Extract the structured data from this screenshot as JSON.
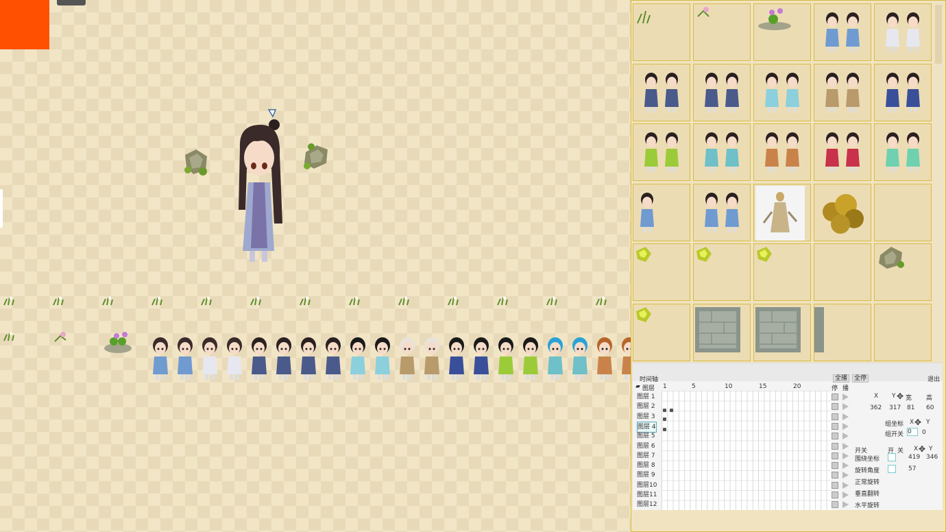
{
  "timeline": {
    "tab_label": "时间轴",
    "layers_header": "图层",
    "frame_numbers": [
      "1",
      "5",
      "10",
      "15",
      "20"
    ],
    "play_all": "全播",
    "stop_all": "全停",
    "exit": "退出",
    "col_stop": "停",
    "col_play": "播",
    "layers": [
      "图层 1",
      "图层 2",
      "图层 3",
      "图层 4",
      "图层 5",
      "图层 6",
      "图层 7",
      "图层 8",
      "图层 9",
      "图层10",
      "图层11",
      "图层12"
    ],
    "selected_layer_index": 3
  },
  "props": {
    "hdr_x": "X",
    "hdr_y": "Y",
    "hdr_w": "宽",
    "hdr_h": "高",
    "x": "362",
    "y": "317",
    "w": "81",
    "h": "60",
    "group_coord_label": "组坐标",
    "gx": "X",
    "gy": "Y",
    "group_switch_label": "组开关",
    "group_switch_val": "0",
    "group_switch_val2": "0",
    "switch_label": "开关",
    "on_label": "开",
    "off_label": "关",
    "orbit_label": "围绕坐标",
    "orbit_x": "419",
    "orbit_y": "346",
    "rotation_label": "旋转角度",
    "rotation_val": "57",
    "normal_rot": "正常旋转",
    "vflip": "垂直翻转",
    "hflip": "水平旋转"
  },
  "colors": {
    "accent_orange": "#ff4f00",
    "panel_border": "#d4b93e"
  }
}
